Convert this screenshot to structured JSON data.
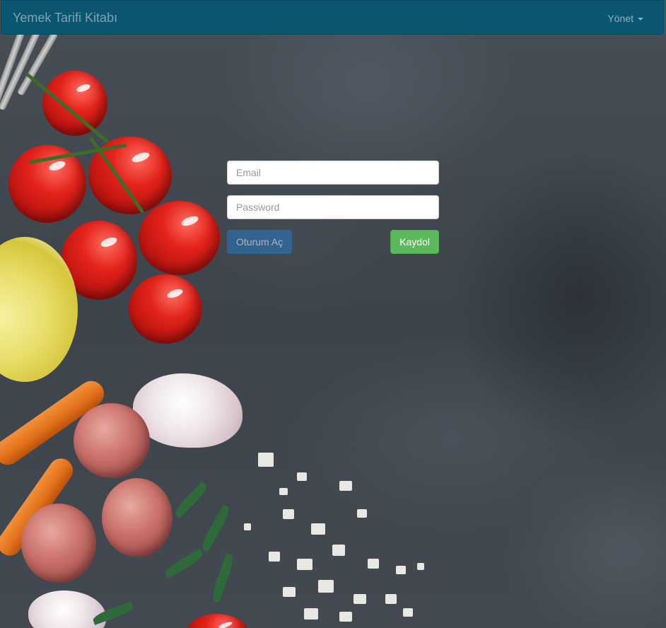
{
  "navbar": {
    "brand": "Yemek Tarifi Kitabı",
    "menu_label": "Yönet"
  },
  "login_form": {
    "email_placeholder": "Email",
    "password_placeholder": "Password",
    "login_button": "Oturum Aç",
    "register_button": "Kaydol"
  },
  "colors": {
    "navbar": "#0a5570",
    "login_button": "#2e6da4",
    "register_button": "#5cb85c"
  }
}
